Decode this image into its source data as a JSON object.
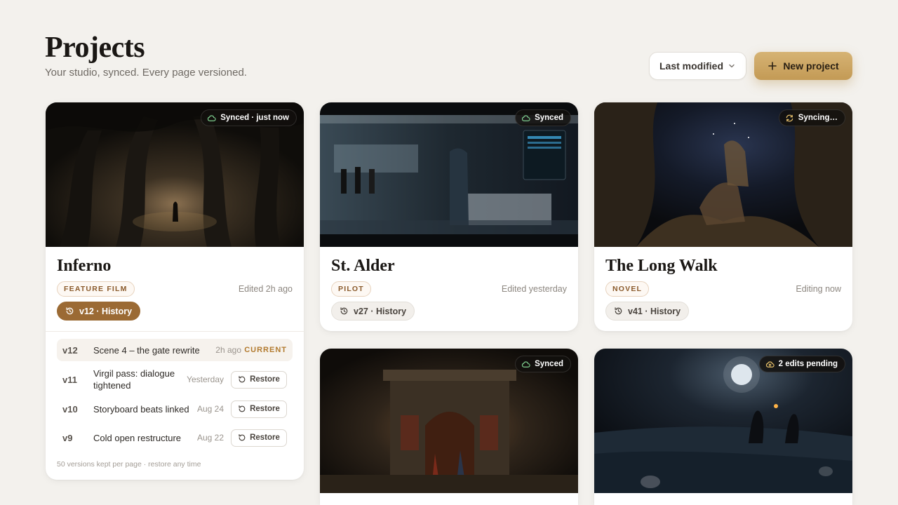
{
  "header": {
    "title": "Projects",
    "subtitle": "Your studio, synced. Every page versioned.",
    "sort_label": "Last modified",
    "new_project_label": "New project"
  },
  "colors": {
    "accent": "#c39a55",
    "version_active": "#9b6a34",
    "tag_text": "#8a5a2b",
    "background": "#f3f1ed"
  },
  "projects": [
    {
      "title": "Inferno",
      "type": "FEATURE FILM",
      "edited": "Edited 2h ago",
      "sync": "Synced · just now",
      "sync_icon": "cloud-icon",
      "version": "v12 · History",
      "history": [
        {
          "version": "v12",
          "description": "Scene 4 – the gate rewrite",
          "when": "2h ago",
          "status": "CURRENT"
        },
        {
          "version": "v11",
          "description": "Virgil pass: dialogue tightened",
          "when": "Yesterday",
          "action": "Restore"
        },
        {
          "version": "v10",
          "description": "Storyboard beats linked",
          "when": "Aug 24",
          "action": "Restore"
        },
        {
          "version": "v9",
          "description": "Cold open restructure",
          "when": "Aug 22",
          "action": "Restore"
        }
      ],
      "history_note": "50 versions kept per page · restore any time"
    },
    {
      "title": "St. Alder",
      "type": "PILOT",
      "edited": "Edited yesterday",
      "sync": "Synced",
      "sync_icon": "cloud-icon",
      "version": "v27 · History"
    },
    {
      "title": "The Long Walk",
      "type": "NOVEL",
      "edited": "Editing now",
      "sync": "Syncing…",
      "sync_icon": "sync-arrows-icon",
      "version": "v41 · History"
    },
    {
      "sync": "Synced",
      "sync_icon": "cloud-icon"
    },
    {
      "sync": "2 edits pending",
      "sync_icon": "cloud-upload-icon"
    }
  ]
}
